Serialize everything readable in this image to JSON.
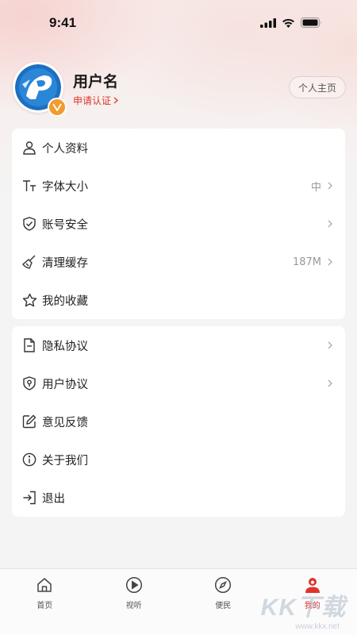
{
  "status_bar": {
    "time": "9:41"
  },
  "profile": {
    "username": "用户名",
    "verify_link": "申请认证",
    "homepage_button": "个人主页"
  },
  "menu_group_1": [
    {
      "label": "个人资料",
      "icon": "user-icon",
      "value": "",
      "chevron": false
    },
    {
      "label": "字体大小",
      "icon": "font-size-icon",
      "value": "中",
      "chevron": true
    },
    {
      "label": "账号安全",
      "icon": "shield-check-icon",
      "value": "",
      "chevron": true
    },
    {
      "label": "清理缓存",
      "icon": "broom-icon",
      "value": "187M",
      "chevron": true
    },
    {
      "label": "我的收藏",
      "icon": "star-icon",
      "value": "",
      "chevron": false
    }
  ],
  "menu_group_2": [
    {
      "label": "隐私协议",
      "icon": "document-icon",
      "value": "",
      "chevron": true
    },
    {
      "label": "用户协议",
      "icon": "shield-user-icon",
      "value": "",
      "chevron": true
    },
    {
      "label": "意见反馈",
      "icon": "edit-icon",
      "value": "",
      "chevron": false
    },
    {
      "label": "关于我们",
      "icon": "info-icon",
      "value": "",
      "chevron": false
    },
    {
      "label": "退出",
      "icon": "logout-icon",
      "value": "",
      "chevron": false
    }
  ],
  "tabbar": [
    {
      "label": "首页",
      "icon": "home-icon",
      "active": false
    },
    {
      "label": "视听",
      "icon": "play-icon",
      "active": false
    },
    {
      "label": "便民",
      "icon": "compass-icon",
      "active": false
    },
    {
      "label": "我的",
      "icon": "profile-icon",
      "active": true
    }
  ],
  "watermark": {
    "brand": "KK下载",
    "url": "www.kkx.net"
  },
  "colors": {
    "accent": "#e0342d",
    "badge": "#f39b2d",
    "background": "#f4f4f4"
  }
}
